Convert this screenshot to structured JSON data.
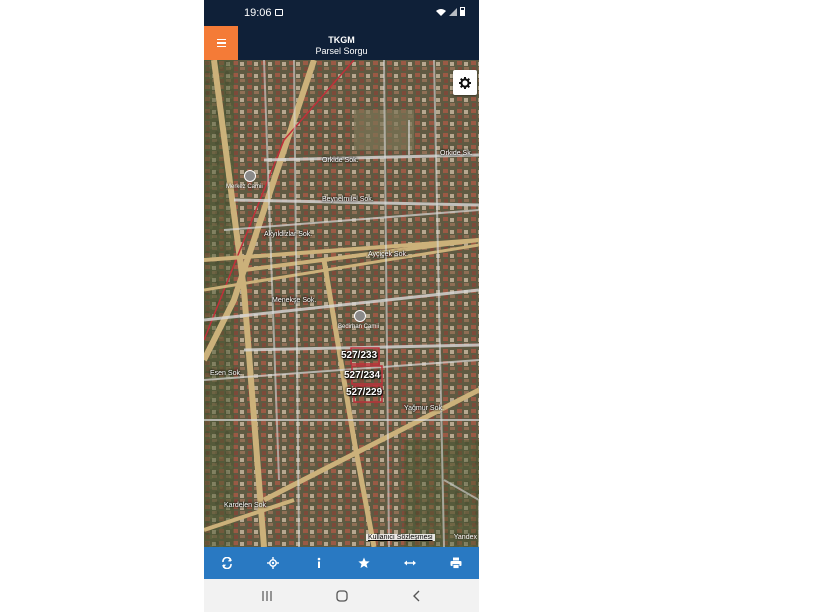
{
  "status_bar": {
    "time": "19:06"
  },
  "app_bar": {
    "title": "TKGM",
    "subtitle": "Parsel Sorgu"
  },
  "map": {
    "parcels": [
      "527/233",
      "527/234",
      "527/229"
    ],
    "streets": [
      "Orkide Sok.",
      "Orkide Sk.",
      "Ayçiçek Sok.",
      "Akyıldızlar Sok.",
      "Beynelmilel Sok.",
      "Menekşe Sok.",
      "Yağmur Sok.",
      "Esen Sok.",
      "Kardelen Sok."
    ],
    "pois": [
      "Merkez Camii",
      "Bedirhan Camii"
    ],
    "terms_link": "Kullanıcı Sözleşmesi",
    "attribution": "Yandex"
  },
  "colors": {
    "header_bg": "#0f2038",
    "menu_button": "#f47b37",
    "toolbar_bg": "#2979c2",
    "nav_bg": "#f2f2f2"
  },
  "toolbar": {
    "icons": [
      "refresh-icon",
      "locate-icon",
      "info-icon",
      "star-icon",
      "measure-icon",
      "print-icon"
    ]
  },
  "nav_bar": {
    "icons": [
      "recents-icon",
      "home-icon",
      "back-icon"
    ]
  }
}
